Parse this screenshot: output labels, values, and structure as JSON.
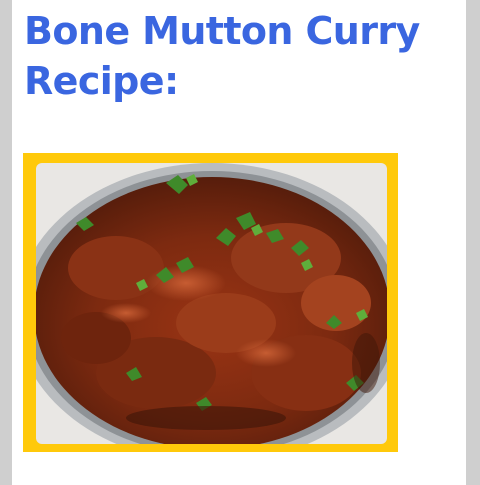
{
  "article": {
    "title": "Bone Mutton Curry Recipe:",
    "image": {
      "subject": "bone mutton curry in a steel bowl garnished with coriander leaves",
      "frame_color": "#ffc90a"
    }
  },
  "colors": {
    "title": "#3a66e0",
    "page_background": "#ffffff",
    "outer_background": "#cfcfcf"
  }
}
